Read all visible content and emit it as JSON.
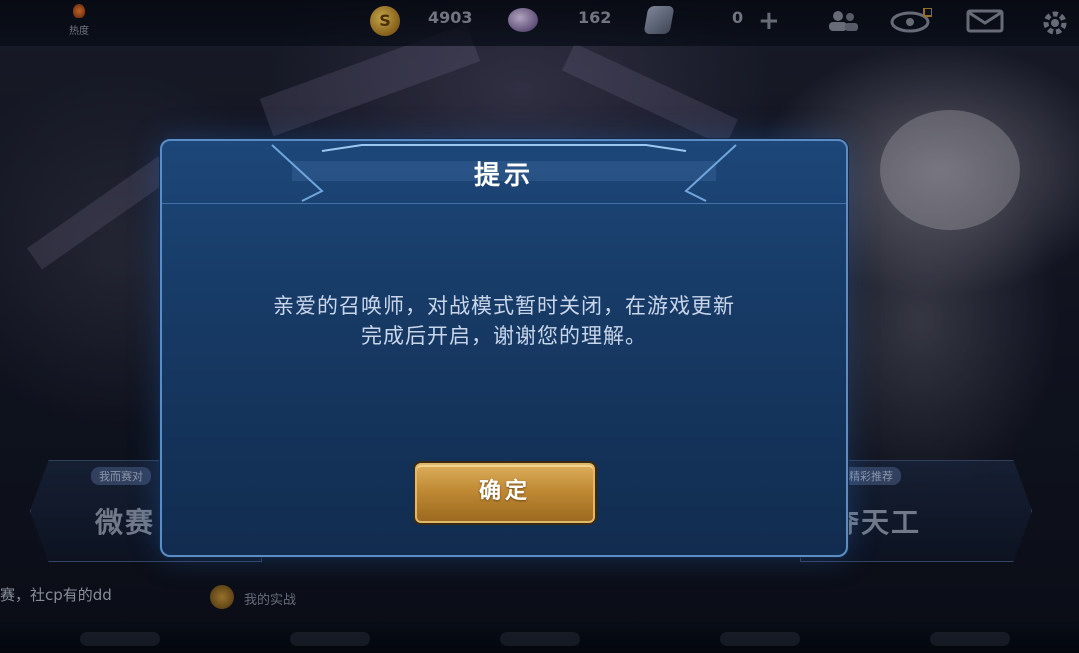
{
  "topbar": {
    "left_label": "热度",
    "gold_symbol": "S",
    "gold": "4903",
    "gems": "162",
    "vouchers": "0",
    "add_symbol": "+"
  },
  "side_left": {
    "tag": "我而赛对",
    "title": "微赛"
  },
  "side_right": {
    "tag": "精彩推荐",
    "title": "巧夺天工"
  },
  "chat": {
    "text": "赛，社cp有的dd"
  },
  "bottom_button": {
    "label": "我的实战"
  },
  "dialog": {
    "title": "提示",
    "message_line1": "亲爱的召唤师，对战模式暂时关闭，在游戏更新",
    "message_line2": "完成后开启，谢谢您的理解。",
    "confirm_label": "确定"
  },
  "colors": {
    "dialog_bg": "#183d6a",
    "dialog_border": "#5b8dc4",
    "button_gold": "#c08a35"
  }
}
